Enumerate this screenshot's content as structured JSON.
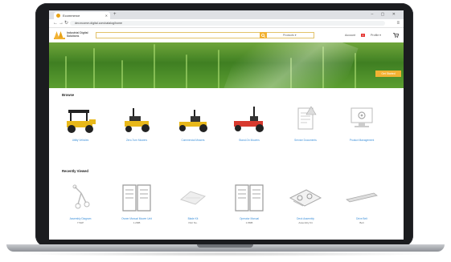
{
  "browser": {
    "tab_title": "Ecommerce",
    "new_tab": "+",
    "window_controls": "– ▢ ✕",
    "back": "←",
    "forward": "→",
    "reload": "↻",
    "url": "dev.ecomm.digital.com/catalog/home",
    "menu": "≡"
  },
  "site": {
    "logo_text": "Industrial Digital Solutions",
    "search_placeholder": "",
    "search_category": "Products ▾",
    "account_label": "Account",
    "cart_count": "2",
    "profile_label": "Profile ▾",
    "accent_color": "#f2b233"
  },
  "hero": {
    "button_label": "Get Started"
  },
  "browse": {
    "title": "Browse",
    "items": [
      {
        "label": "Utility Vehicles",
        "icon": "utility-vehicle"
      },
      {
        "label": "Zero-Turn Mowers",
        "icon": "zero-turn-mower"
      },
      {
        "label": "Commercial Mowers",
        "icon": "commercial-mower"
      },
      {
        "label": "Stand-On Mowers",
        "icon": "stand-on-mower"
      },
      {
        "label": "Service Documents",
        "icon": "document"
      },
      {
        "label": "Product Management",
        "icon": "settings-monitor"
      }
    ]
  },
  "recent": {
    "title": "Recently Viewed",
    "items": [
      {
        "label": "Assembly Diagram",
        "sub": "7.5HP",
        "icon": "parts-diagram"
      },
      {
        "label": "Owner Manual Mower Unit",
        "sub": "1.2MB",
        "icon": "book"
      },
      {
        "label": "Blade Kit",
        "sub": "Part No.",
        "icon": "blade-part"
      },
      {
        "label": "Operator Manual",
        "sub": "1.8MB",
        "icon": "book"
      },
      {
        "label": "Deck Assembly",
        "sub": "Assembly Kit",
        "icon": "deck-assembly"
      },
      {
        "label": "Drive Belt",
        "sub": "Belt",
        "icon": "belt-part"
      }
    ]
  }
}
